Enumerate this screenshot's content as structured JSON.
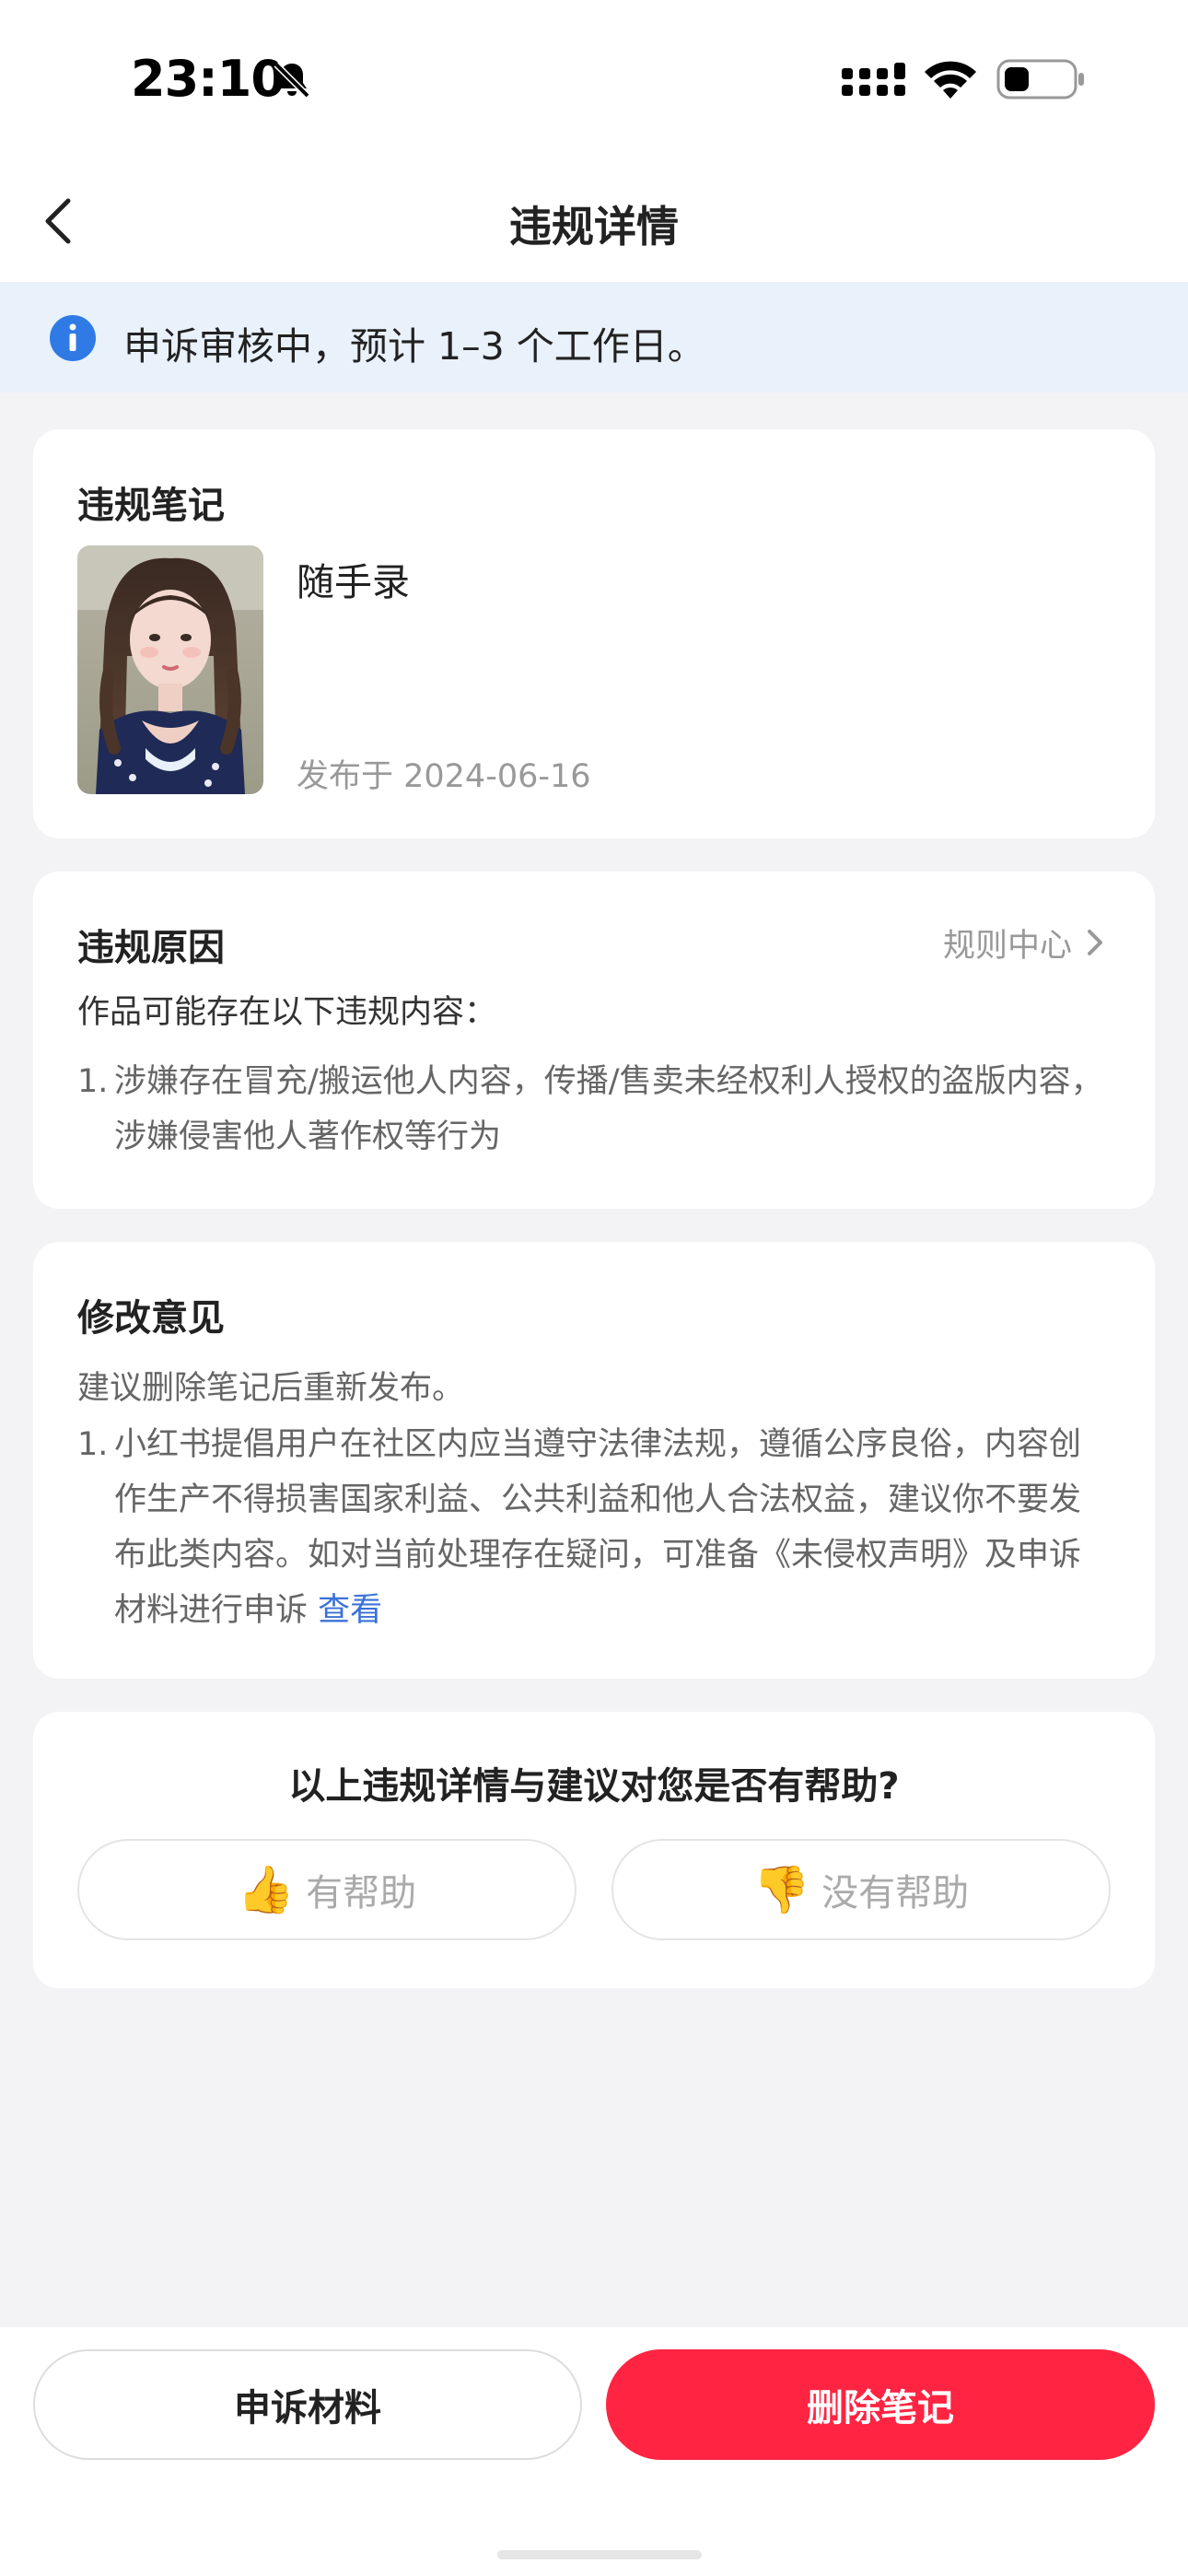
{
  "status_bar": {
    "time": "23:10",
    "icons": [
      "bell-slash-icon",
      "signal-icon",
      "wifi-icon",
      "battery-icon"
    ]
  },
  "nav": {
    "title": "违规详情",
    "back_icon": "chevron-left-icon"
  },
  "banner": {
    "icon": "info-icon",
    "text": "申诉审核中，预计 1–3 个工作日。",
    "accent": "#2f7ae5"
  },
  "note_card": {
    "title": "违规笔记",
    "note_name": "随手录",
    "published": "发布于 2024-06-16"
  },
  "reason_card": {
    "title": "违规原因",
    "rule_center": "规则中心",
    "intro": "作品可能存在以下违规内容：",
    "items": [
      {
        "num": "1.",
        "text": "涉嫌存在冒充/搬运他人内容，传播/售卖未经权利人授权的盗版内容，涉嫌侵害他人著作权等行为"
      }
    ]
  },
  "advice_card": {
    "title": "修改意见",
    "intro": "建议删除笔记后重新发布。",
    "items": [
      {
        "num": "1.",
        "text": "小红书提倡用户在社区内应当遵守法律法规，遵循公序良俗，内容创作生产不得损害国家利益、公共利益和他人合法权益，建议你不要发布此类内容。如对当前处理存在疑问，可准备《未侵权声明》及申诉材料进行申诉",
        "link": "查看"
      }
    ]
  },
  "help_card": {
    "question": "以上违规详情与建议对您是否有帮助?",
    "helpful": {
      "icon": "👍",
      "label": "有帮助"
    },
    "not_helpful": {
      "icon": "👎",
      "label": "没有帮助"
    }
  },
  "bottom": {
    "appeal": "申诉材料",
    "delete": "删除笔记",
    "delete_color": "#ff2442"
  }
}
